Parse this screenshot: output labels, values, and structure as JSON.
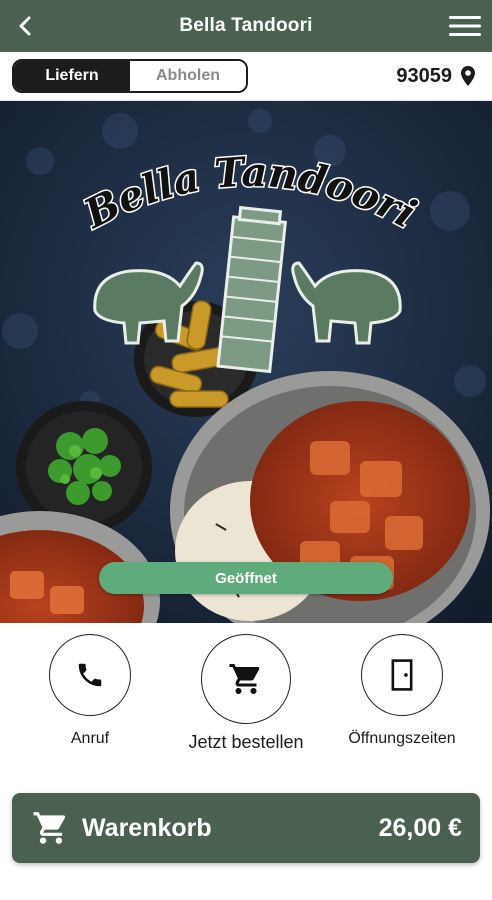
{
  "header": {
    "title": "Bella Tandoori",
    "back_icon": "arrow-left-icon",
    "menu_icon": "hamburger-menu-icon"
  },
  "mode": {
    "options": [
      "Liefern",
      "Abholen"
    ],
    "selected": "Liefern"
  },
  "location": {
    "zip": "93059",
    "icon": "map-pin-icon"
  },
  "hero": {
    "logo_text": "Bella Tandoori",
    "status": "Geöffnet"
  },
  "actions": [
    {
      "label": "Anruf",
      "icon": "phone-icon"
    },
    {
      "label": "Jetzt bestellen",
      "icon": "cart-icon"
    },
    {
      "label": "Öffnungszeiten",
      "icon": "door-icon"
    }
  ],
  "cart": {
    "label": "Warenkorb",
    "total": "26,00 €",
    "icon": "cart-icon"
  },
  "colors": {
    "primary": "#4a6150",
    "status_green": "#5fab7c",
    "dark": "#1c1c1c"
  }
}
